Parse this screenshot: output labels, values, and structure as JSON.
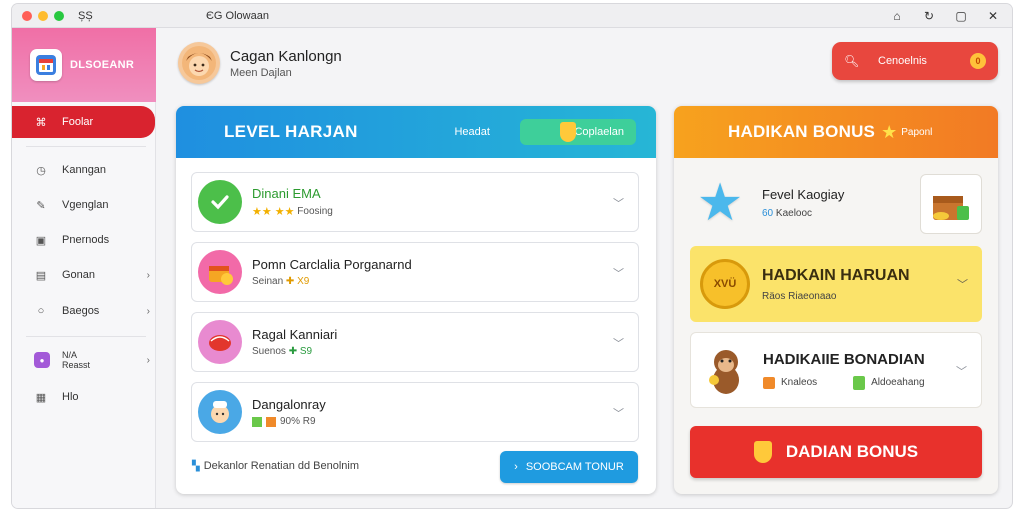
{
  "titlebar": {
    "app_label": "ȘȘ",
    "title": "ЄG Olowaan",
    "controls": [
      "home-icon",
      "refresh-icon",
      "maximize-icon",
      "close-icon"
    ]
  },
  "sidebar": {
    "app_name": "DLSOEANR",
    "active_item": "Foolar",
    "items": [
      {
        "label": "Kanngan",
        "icon": "clock-icon"
      },
      {
        "label": "Vgenglan",
        "icon": "pencil-icon"
      },
      {
        "label": "Pnernods",
        "icon": "image-icon"
      },
      {
        "label": "Gonan",
        "icon": "clipboard-icon",
        "chevron": true
      },
      {
        "label": "Baegos",
        "icon": "circle-icon",
        "chevron": true
      },
      {
        "label_line1": "N/A",
        "label_line2": "Reasst",
        "icon": "badge-icon",
        "chevron": true
      },
      {
        "label": "Hlo",
        "icon": "calculator-icon"
      }
    ]
  },
  "user": {
    "name": "Cagan Kanlongn",
    "subtitle": "Meen Dajlan"
  },
  "top_button": {
    "label": "Cenoelnis",
    "icon": "search-icon",
    "coin": "0"
  },
  "level_panel": {
    "title": "LEVEL HARJAN",
    "header_pre": "Headat",
    "header_button": "Coplaelan",
    "tasks": [
      {
        "title": "Dinani EMA",
        "sub": "Foosing",
        "icon": "check-icon",
        "stars": "★★  ★★"
      },
      {
        "title": "Pomn Carclalia Porganarnd",
        "sub": "Seinan",
        "extra": "✚ X9",
        "icon": "cake-icon"
      },
      {
        "title": "Ragal Kanniari",
        "sub": "Suenos",
        "extra": "✚ S9",
        "icon": "candy-icon"
      },
      {
        "title": "Dangalonray",
        "sub": "90% R9",
        "icon": "chef-icon"
      }
    ],
    "footer_note": "Dekanlor Renatian dd Benolnim",
    "footer_button": "SOOBCAM TONUR"
  },
  "bonus_panel": {
    "title": "HADIKAN BONUS",
    "title_sub": "Paponl",
    "reward": {
      "title": "Fevel Kaogiay",
      "sub": "Kaelooc",
      "sub_prefix": "60"
    },
    "card_yellow": {
      "title": "HADKAIN HARUAN",
      "sub": "Räos Riaeonaao",
      "coin_text": "XVÜ"
    },
    "card_white": {
      "title": "HADIKAIIE BONADIAN",
      "sub1": "Knaleos",
      "sub2": "Aldoeahang"
    },
    "button": "DADIAN BONUS"
  },
  "colors": {
    "sidebar_active": "#d9232f",
    "level_header": "#1f8fe0",
    "bonus_header": "#f7a21e",
    "bonus_button": "#e8312c",
    "accent_green": "#3ecf9a"
  }
}
